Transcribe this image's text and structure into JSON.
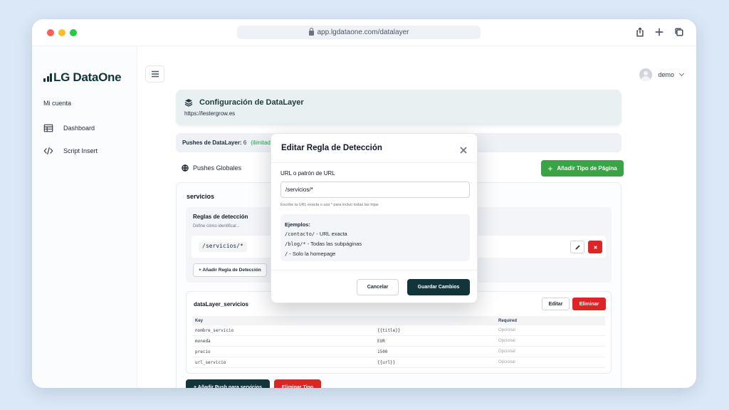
{
  "browser": {
    "url": "app.lgdataone.com/datalayer",
    "colors": {
      "close": "#ff5f57",
      "minimize": "#febc2e",
      "maximize": "#28c840"
    }
  },
  "sidebar": {
    "logo_text": "LG DataOne",
    "account_label": "Mi cuenta",
    "items": [
      {
        "label": "Dashboard",
        "icon": "table-icon"
      },
      {
        "label": "Script Insert",
        "icon": "code-icon"
      }
    ]
  },
  "header": {
    "user_name": "demo"
  },
  "config": {
    "title": "Configuración de DataLayer",
    "site_url": "https://lestergrow.es"
  },
  "pushes": {
    "label": "Pushes de DataLayer:",
    "count": "6",
    "limit": "(ilimitado)"
  },
  "global_pushes_label": "Pushes Globales",
  "add_page_type_label": "Añadir Tipo de Página",
  "section": {
    "title": "servicios",
    "rules": {
      "title": "Reglas de detección",
      "subtitle": "Define cómo identificar...",
      "pattern": "/servicios/*",
      "add_label": "+ Añadir Regla de Detección"
    },
    "datalayer": {
      "title": "dataLayer_servicios",
      "edit_label": "Editar",
      "delete_label": "Eliminar",
      "columns": [
        "Key",
        "",
        "Required"
      ],
      "rows": [
        {
          "key": "nombre_servicio",
          "value": "{{title}}",
          "required": "Opcional"
        },
        {
          "key": "moneda",
          "value": "EUR",
          "required": "Opcional"
        },
        {
          "key": "precio",
          "value": "1500",
          "required": "Opcional"
        },
        {
          "key": "url_servicio",
          "value": "{{url}}",
          "required": "Opcional"
        }
      ]
    },
    "add_push_label": "+ Añadir Push para servicios",
    "delete_type_label": "Eliminar Tipo"
  },
  "modal": {
    "title": "Editar Regla de Detección",
    "field_label": "URL o patrón de URL",
    "field_value": "/servicios/*",
    "hint": "Escribe la URL exacta o usa * para incluir todas las hijas",
    "examples_title": "Ejemplos:",
    "examples": [
      {
        "code": "/contacto/",
        "desc": " - URL exacta"
      },
      {
        "code": "/blog/*",
        "desc": " - Todas las subpáginas"
      },
      {
        "code": "/",
        "desc": " - Solo la homepage"
      }
    ],
    "cancel_label": "Cancelar",
    "save_label": "Guardar Cambios"
  },
  "colors": {
    "brand_dark": "#12343b",
    "green": "#3aa346",
    "red": "#dc2626",
    "limit_green": "#16a34a"
  }
}
